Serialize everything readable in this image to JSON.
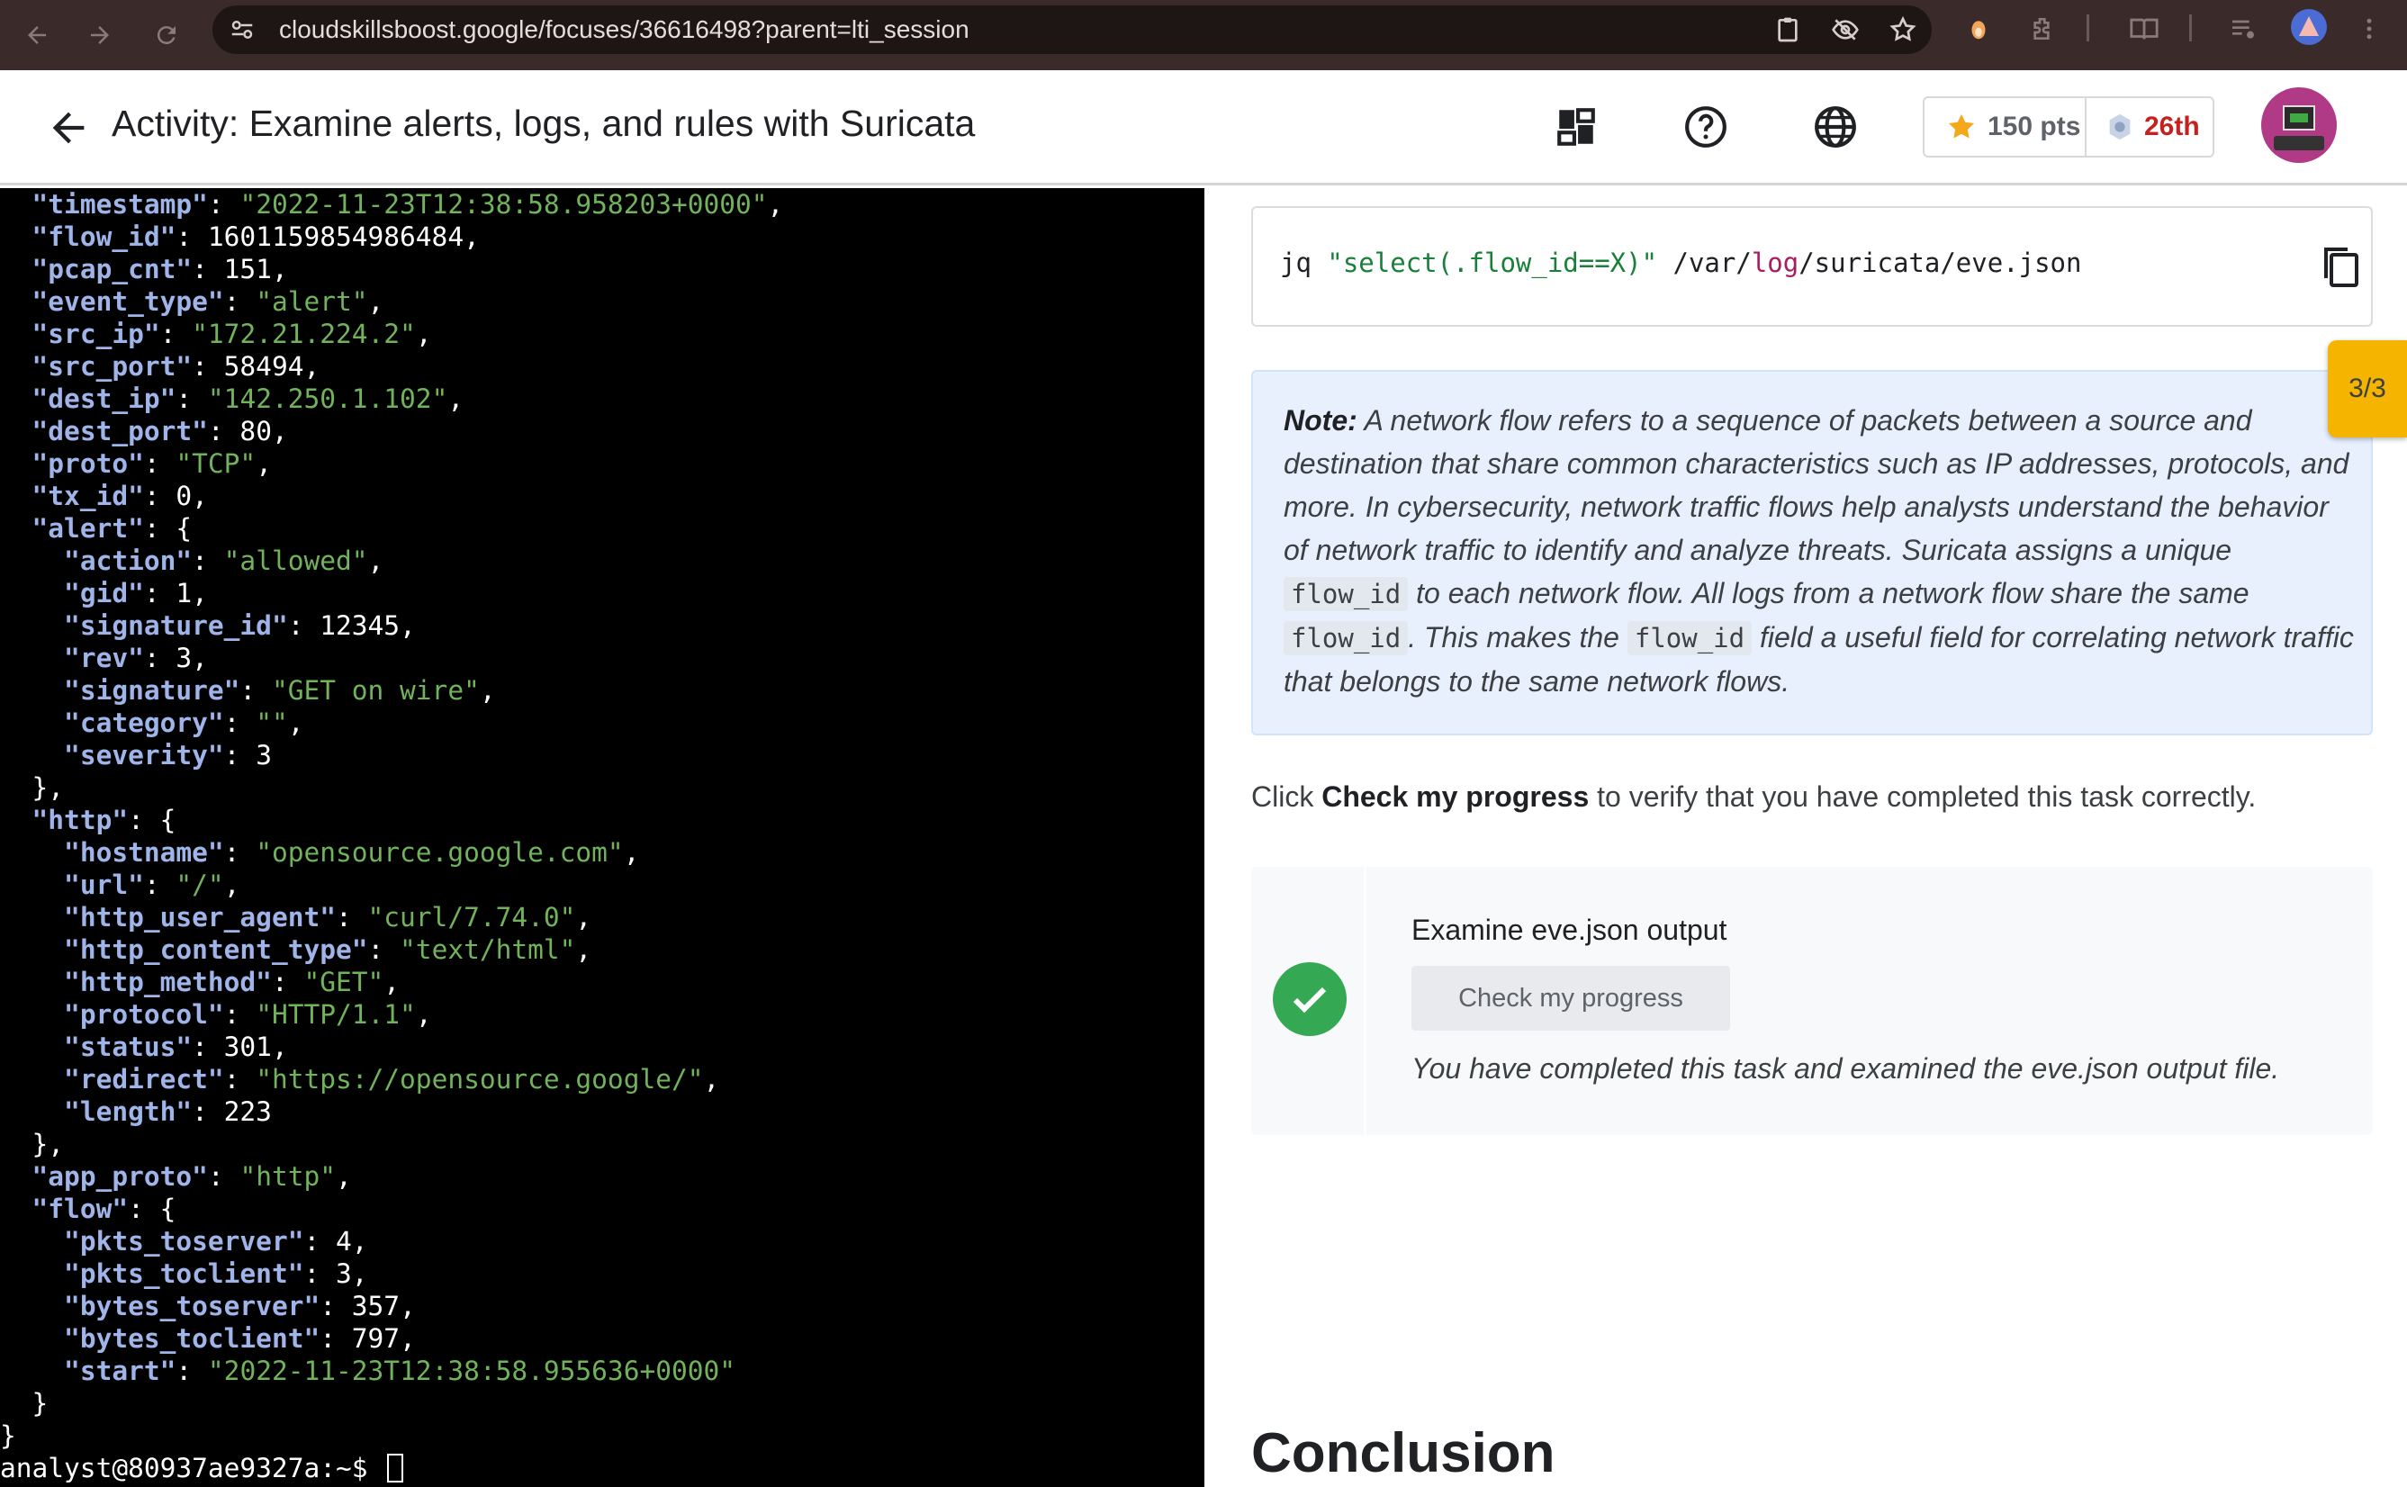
{
  "browser": {
    "url": "cloudskillsboost.google/focuses/36616498?parent=lti_session"
  },
  "header": {
    "title": "Activity: Examine alerts, logs, and rules with Suricata",
    "points": "150 pts",
    "rank": "26th"
  },
  "terminal": {
    "lines": [
      [
        [
          "k",
          "\"timestamp\""
        ],
        [
          "p",
          ": "
        ],
        [
          "s",
          "\"2022-11-23T12:38:58.958203+0000\""
        ],
        [
          "p",
          ","
        ]
      ],
      [
        [
          "k",
          "\"flow_id\""
        ],
        [
          "p",
          ": 1601159854986484,"
        ]
      ],
      [
        [
          "k",
          "\"pcap_cnt\""
        ],
        [
          "p",
          ": 151,"
        ]
      ],
      [
        [
          "k",
          "\"event_type\""
        ],
        [
          "p",
          ": "
        ],
        [
          "s",
          "\"alert\""
        ],
        [
          "p",
          ","
        ]
      ],
      [
        [
          "k",
          "\"src_ip\""
        ],
        [
          "p",
          ": "
        ],
        [
          "s",
          "\"172.21.224.2\""
        ],
        [
          "p",
          ","
        ]
      ],
      [
        [
          "k",
          "\"src_port\""
        ],
        [
          "p",
          ": 58494,"
        ]
      ],
      [
        [
          "k",
          "\"dest_ip\""
        ],
        [
          "p",
          ": "
        ],
        [
          "s",
          "\"142.250.1.102\""
        ],
        [
          "p",
          ","
        ]
      ],
      [
        [
          "k",
          "\"dest_port\""
        ],
        [
          "p",
          ": 80,"
        ]
      ],
      [
        [
          "k",
          "\"proto\""
        ],
        [
          "p",
          ": "
        ],
        [
          "s",
          "\"TCP\""
        ],
        [
          "p",
          ","
        ]
      ],
      [
        [
          "k",
          "\"tx_id\""
        ],
        [
          "p",
          ": 0,"
        ]
      ],
      [
        [
          "k",
          "\"alert\""
        ],
        [
          "p",
          ": {"
        ]
      ],
      [
        [
          "k",
          "  \"action\""
        ],
        [
          "p",
          ": "
        ],
        [
          "s",
          "\"allowed\""
        ],
        [
          "p",
          ","
        ]
      ],
      [
        [
          "k",
          "  \"gid\""
        ],
        [
          "p",
          ": 1,"
        ]
      ],
      [
        [
          "k",
          "  \"signature_id\""
        ],
        [
          "p",
          ": 12345,"
        ]
      ],
      [
        [
          "k",
          "  \"rev\""
        ],
        [
          "p",
          ": 3,"
        ]
      ],
      [
        [
          "k",
          "  \"signature\""
        ],
        [
          "p",
          ": "
        ],
        [
          "s",
          "\"GET on wire\""
        ],
        [
          "p",
          ","
        ]
      ],
      [
        [
          "k",
          "  \"category\""
        ],
        [
          "p",
          ": "
        ],
        [
          "s",
          "\"\""
        ],
        [
          "p",
          ","
        ]
      ],
      [
        [
          "k",
          "  \"severity\""
        ],
        [
          "p",
          ": 3"
        ]
      ],
      [
        [
          "p",
          "},"
        ]
      ],
      [
        [
          "k",
          "\"http\""
        ],
        [
          "p",
          ": {"
        ]
      ],
      [
        [
          "k",
          "  \"hostname\""
        ],
        [
          "p",
          ": "
        ],
        [
          "s",
          "\"opensource.google.com\""
        ],
        [
          "p",
          ","
        ]
      ],
      [
        [
          "k",
          "  \"url\""
        ],
        [
          "p",
          ": "
        ],
        [
          "s",
          "\"/\""
        ],
        [
          "p",
          ","
        ]
      ],
      [
        [
          "k",
          "  \"http_user_agent\""
        ],
        [
          "p",
          ": "
        ],
        [
          "s",
          "\"curl/7.74.0\""
        ],
        [
          "p",
          ","
        ]
      ],
      [
        [
          "k",
          "  \"http_content_type\""
        ],
        [
          "p",
          ": "
        ],
        [
          "s",
          "\"text/html\""
        ],
        [
          "p",
          ","
        ]
      ],
      [
        [
          "k",
          "  \"http_method\""
        ],
        [
          "p",
          ": "
        ],
        [
          "s",
          "\"GET\""
        ],
        [
          "p",
          ","
        ]
      ],
      [
        [
          "k",
          "  \"protocol\""
        ],
        [
          "p",
          ": "
        ],
        [
          "s",
          "\"HTTP/1.1\""
        ],
        [
          "p",
          ","
        ]
      ],
      [
        [
          "k",
          "  \"status\""
        ],
        [
          "p",
          ": 301,"
        ]
      ],
      [
        [
          "k",
          "  \"redirect\""
        ],
        [
          "p",
          ": "
        ],
        [
          "s",
          "\"https://opensource.google/\""
        ],
        [
          "p",
          ","
        ]
      ],
      [
        [
          "k",
          "  \"length\""
        ],
        [
          "p",
          ": 223"
        ]
      ],
      [
        [
          "p",
          "},"
        ]
      ],
      [
        [
          "k",
          "\"app_proto\""
        ],
        [
          "p",
          ": "
        ],
        [
          "s",
          "\"http\""
        ],
        [
          "p",
          ","
        ]
      ],
      [
        [
          "k",
          "\"flow\""
        ],
        [
          "p",
          ": {"
        ]
      ],
      [
        [
          "k",
          "  \"pkts_toserver\""
        ],
        [
          "p",
          ": 4,"
        ]
      ],
      [
        [
          "k",
          "  \"pkts_toclient\""
        ],
        [
          "p",
          ": 3,"
        ]
      ],
      [
        [
          "k",
          "  \"bytes_toserver\""
        ],
        [
          "p",
          ": 357,"
        ]
      ],
      [
        [
          "k",
          "  \"bytes_toclient\""
        ],
        [
          "p",
          ": 797,"
        ]
      ],
      [
        [
          "k",
          "  \"start\""
        ],
        [
          "p",
          ": "
        ],
        [
          "s",
          "\"2022-11-23T12:38:58.955636+0000\""
        ]
      ],
      [
        [
          "p",
          "}"
        ]
      ]
    ],
    "closing_brace": "}",
    "prompt": "analyst@80937ae9327a:~$ "
  },
  "command": {
    "cmd": "jq ",
    "filter": "\"select(.flow_id==X)\"",
    "path_a": " /var/",
    "path_log": "log",
    "path_b": "/suricata/eve.json"
  },
  "note": {
    "label": "Note:",
    "text_1": " A network flow refers to a sequence of packets between a source and destination that share common characteristics such as IP addresses, protocols, and more. In cybersecurity, network traffic flows help analysts understand the behavior of network traffic to identify and analyze threats. Suricata assigns a unique ",
    "code_1": "flow_id",
    "text_2": " to each network flow. All logs from a network flow share the same ",
    "code_2": "flow_id",
    "text_3": ". This makes the ",
    "code_3": "flow_id",
    "text_4": " field a useful field for correlating network traffic that belongs to the same network flows."
  },
  "side_tab": "3/3",
  "instruction": {
    "prefix": "Click ",
    "bold": "Check my progress",
    "suffix": " to verify that you have completed this task correctly."
  },
  "task": {
    "title": "Examine eve.json output",
    "button": "Check my progress",
    "message": "You have completed this task and examined the eve.json output file."
  },
  "conclusion": "Conclusion",
  "colors": {
    "terminal_key": "#9fb4e8",
    "terminal_string": "#71b35a",
    "success": "#34a853",
    "rank": "#c5221f",
    "note_bg": "#e8f0fe",
    "side_tab": "#f4b400"
  }
}
